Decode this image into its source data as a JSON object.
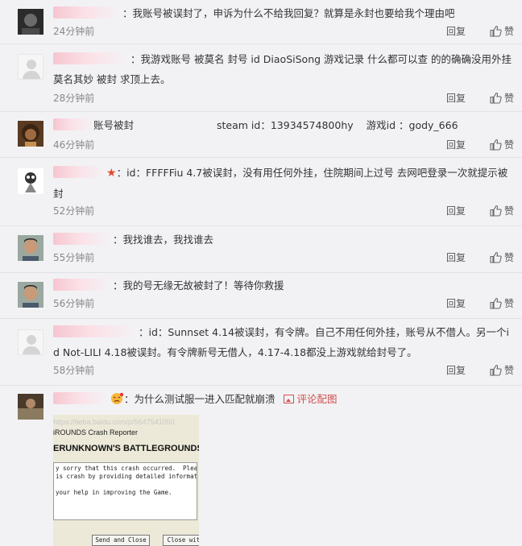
{
  "actions": {
    "reply": "回复",
    "like": "赞"
  },
  "comments": [
    {
      "text": "：我账号被误封了，申诉为什么不给我回复？就算是永封也要给我个理由吧",
      "time": "24分钟前"
    },
    {
      "text": "：我游戏账号 被莫名 封号    id DiaoSiSong    游戏记录 什么都可以查    的的确确没用外挂    莫名其妙 被封    求顶上去。",
      "time": "28分钟前"
    },
    {
      "text_a": "账号被封",
      "text_b": "steam id：13934574800hy",
      "text_c": "游戏id ：gody_666",
      "time": "46分钟前"
    },
    {
      "star": "★",
      "text": "：id：FFFFFiu   4.7被误封，没有用任何外挂，住院期间上过号 去网吧登录一次就提示被封",
      "time": "52分钟前"
    },
    {
      "text": "：我找谁去，我找谁去",
      "time": "55分钟前"
    },
    {
      "text": "：我的号无缘无故被封了！等待你救援",
      "time": "56分钟前"
    },
    {
      "text": "：id：Sunnset   4.14被误封，有令牌。自己不用任何外挂，账号从不借人。另一个id Not-LILI 4.18被误封。有令牌新号无借人，4.17-4.18都没上游戏就给封号了。",
      "time": "58分钟前"
    },
    {
      "text": "：为什么测试服一进入匹配就崩溃",
      "pic_link": "评论配图"
    }
  ],
  "screenshot": {
    "url": "https://tieba.baidu.com/p/5647541050",
    "caption": "iROUNDS Crash Reporter",
    "game": "ERUNKNOWN'S BATTLEGROUNDS p",
    "message": "y sorry that this crash occurred.  Please help\nis crash by providing detailed information ab\n\nyour help in improving the Game.",
    "btn_send": "Send and Close",
    "btn_close": "Close wit"
  }
}
